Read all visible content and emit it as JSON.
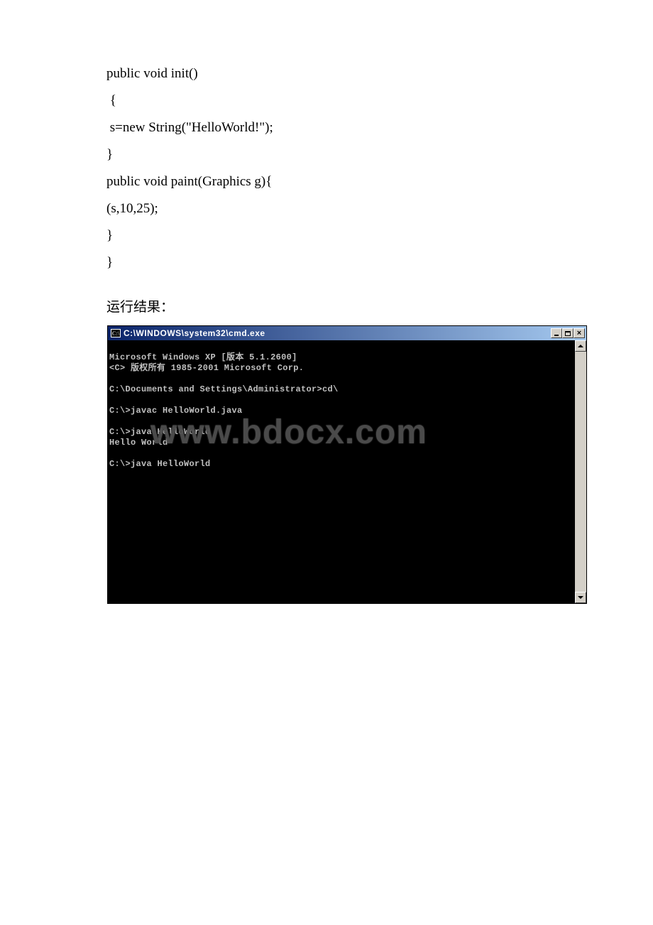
{
  "code": {
    "l1": "public void init()",
    "l2": " {",
    "l3": " s=new String(\"HelloWorld!\");",
    "l4": "}",
    "l5": "public void paint(Graphics g){",
    "l6": "(s,10,25);",
    "l7": "}",
    "l8": "}"
  },
  "result_label": "运行结果：",
  "console": {
    "title": "C:\\WINDOWS\\system32\\cmd.exe",
    "icon_text": "C:\\",
    "lines": {
      "l1": "Microsoft Windows XP [版本 5.1.2600]",
      "l2": "<C> 版权所有 1985-2001 Microsoft Corp.",
      "l3": "",
      "l4": "C:\\Documents and Settings\\Administrator>cd\\",
      "l5": "",
      "l6": "C:\\>javac HelloWorld.java",
      "l7": "",
      "l8": "C:\\>java HelloWorld",
      "l9": "Hello World",
      "l10": "",
      "l11": "C:\\>java HelloWorld"
    },
    "close_label": "×",
    "watermark": "www.bdocx.com"
  }
}
